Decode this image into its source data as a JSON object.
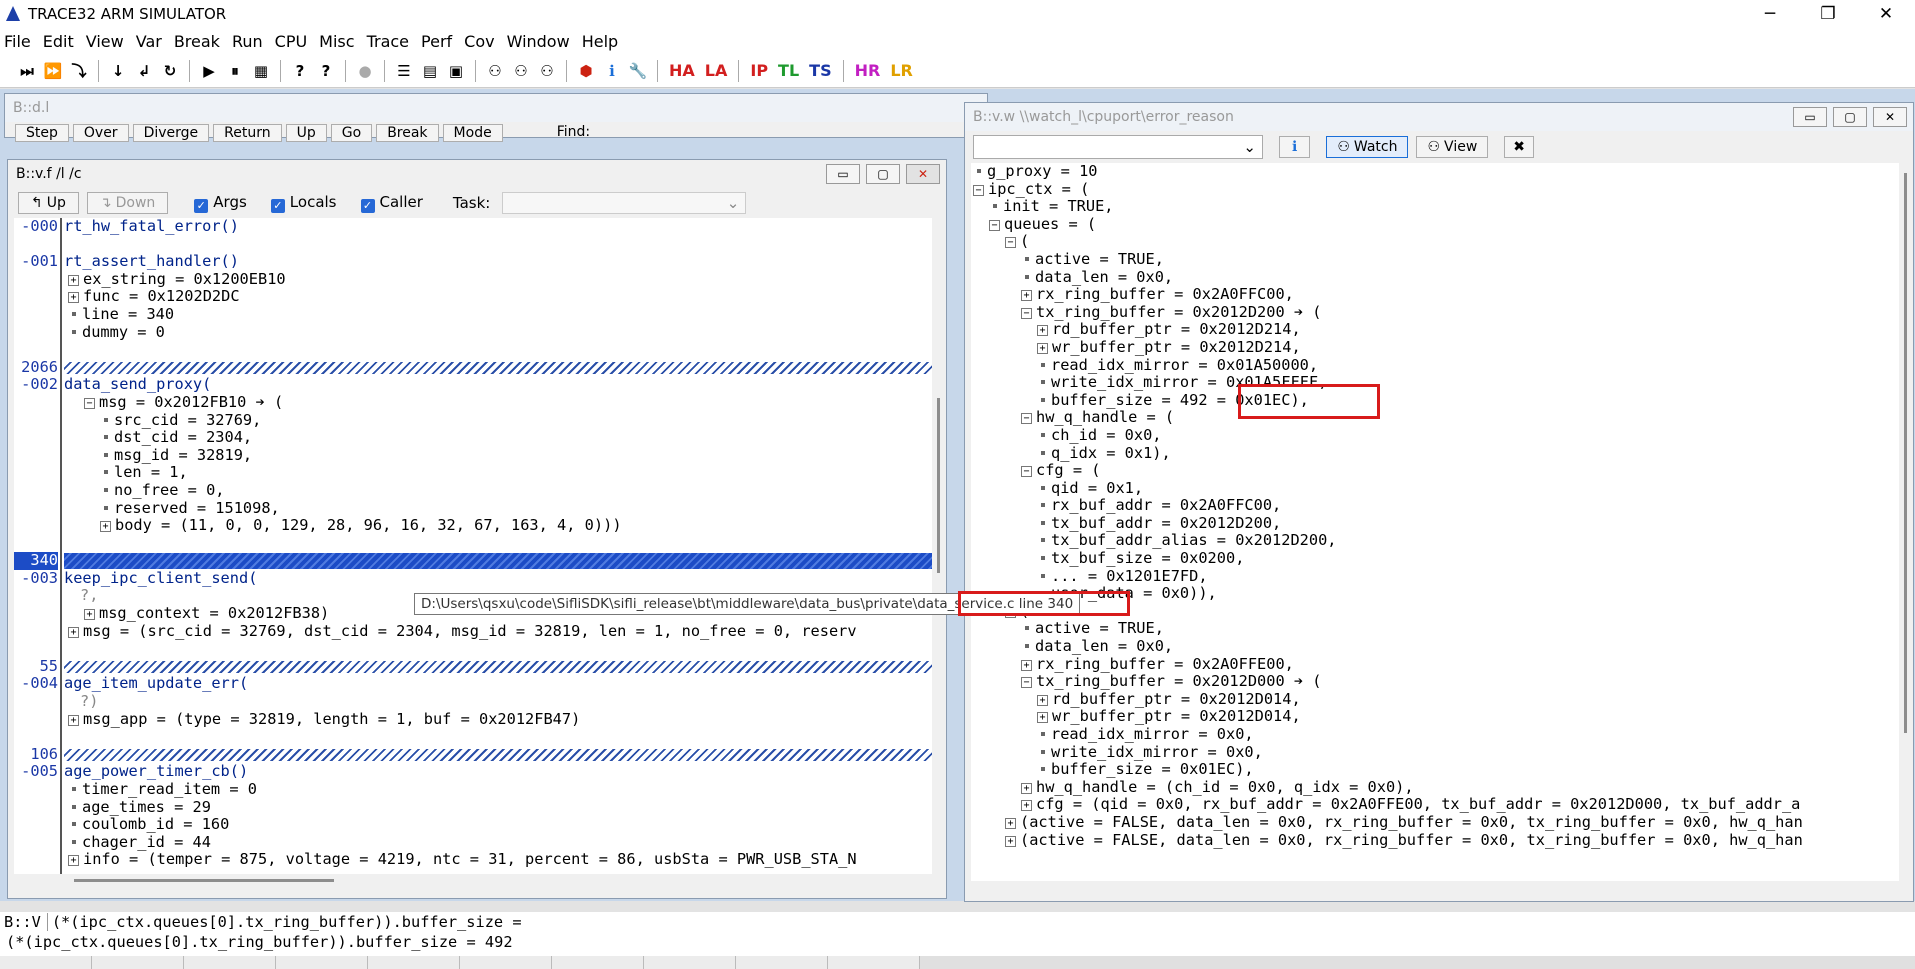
{
  "app": {
    "title": "TRACE32 ARM SIMULATOR"
  },
  "window_controls": {
    "min": "─",
    "max": "❐",
    "close": "✕"
  },
  "menu": [
    "File",
    "Edit",
    "View",
    "Var",
    "Break",
    "Run",
    "CPU",
    "Misc",
    "Trace",
    "Perf",
    "Cov",
    "Window",
    "Help"
  ],
  "toolbar": {
    "text_buttons": [
      {
        "label": "HA",
        "color": "#d21f1f"
      },
      {
        "label": "LA",
        "color": "#d21f1f"
      },
      {
        "label": "IP",
        "color": "#d21f1f"
      },
      {
        "label": "TL",
        "color": "#1e9a2e"
      },
      {
        "label": "TS",
        "color": "#1a37a6"
      },
      {
        "label": "HR",
        "color": "#c21fc2"
      },
      {
        "label": "LR",
        "color": "#e0a000"
      }
    ]
  },
  "list_window": {
    "title": "B::d.l",
    "buttons": [
      "Step",
      "Over",
      "Diverge",
      "Return",
      "Up",
      "Go",
      "Break",
      "Mode"
    ],
    "find_label": "Find:"
  },
  "frame_window": {
    "title": "B::v.f /l /c",
    "up": "Up",
    "down": "Down",
    "args": "Args",
    "locals": "Locals",
    "caller": "Caller",
    "task_label": "Task:",
    "rows": [
      {
        "ln": "-000",
        "text": "rt_hw_fatal_error()",
        "k": "fn"
      },
      {
        "ln": "",
        "text": "",
        "k": "blank"
      },
      {
        "ln": "-001",
        "text": "rt_assert_handler()",
        "k": "fn"
      },
      {
        "ln": "",
        "text": "ex_string = 0x1200EB10",
        "k": "plus",
        "ind": 0
      },
      {
        "ln": "",
        "text": "func = 0x1202D2DC",
        "k": "plus",
        "ind": 0
      },
      {
        "ln": "",
        "text": "line = 340",
        "k": "dot",
        "ind": 0
      },
      {
        "ln": "",
        "text": "dummy = 0",
        "k": "dot",
        "ind": 0
      },
      {
        "ln": "",
        "text": "",
        "k": "blank"
      },
      {
        "ln": "2066",
        "text": "",
        "k": "hatch"
      },
      {
        "ln": "-002",
        "text": "data_send_proxy(",
        "k": "fn"
      },
      {
        "ln": "",
        "text": "msg = 0x2012FB10 ➔ (",
        "k": "minus",
        "ind": 1
      },
      {
        "ln": "",
        "text": "src_cid = 32769,",
        "k": "dot",
        "ind": 2
      },
      {
        "ln": "",
        "text": "dst_cid = 2304,",
        "k": "dot",
        "ind": 2
      },
      {
        "ln": "",
        "text": "msg_id = 32819,",
        "k": "dot",
        "ind": 2
      },
      {
        "ln": "",
        "text": "len = 1,",
        "k": "dot",
        "ind": 2
      },
      {
        "ln": "",
        "text": "no_free = 0,",
        "k": "dot",
        "ind": 2
      },
      {
        "ln": "",
        "text": "reserved = 151098,",
        "k": "dot",
        "ind": 2
      },
      {
        "ln": "",
        "text": "body = (11, 0, 0, 129, 28, 96, 16, 32, 67, 163, 4, 0)))",
        "k": "plus",
        "ind": 2
      },
      {
        "ln": "",
        "text": "",
        "k": "blank"
      },
      {
        "ln": "340",
        "text": "",
        "k": "hatchsel"
      },
      {
        "ln": "-003",
        "text": "keep_ipc_client_send(",
        "k": "fn"
      },
      {
        "ln": "",
        "text": "?,",
        "k": "q"
      },
      {
        "ln": "",
        "text": "msg_context = 0x2012FB38)",
        "k": "plus",
        "ind": 1
      },
      {
        "ln": "",
        "text": "msg = (src_cid = 32769, dst_cid = 2304, msg_id = 32819, len = 1, no_free = 0, reserv",
        "k": "plus",
        "ind": 0
      },
      {
        "ln": "",
        "text": "",
        "k": "blank"
      },
      {
        "ln": "55",
        "text": "",
        "k": "hatch"
      },
      {
        "ln": "-004",
        "text": "age_item_update_err(",
        "k": "fn"
      },
      {
        "ln": "",
        "text": "?)",
        "k": "q"
      },
      {
        "ln": "",
        "text": "msg_app = (type = 32819, length = 1, buf = 0x2012FB47)",
        "k": "plus",
        "ind": 0
      },
      {
        "ln": "",
        "text": "",
        "k": "blank"
      },
      {
        "ln": "106",
        "text": "",
        "k": "hatch"
      },
      {
        "ln": "-005",
        "text": "age_power_timer_cb()",
        "k": "fn"
      },
      {
        "ln": "",
        "text": "timer_read_item = 0",
        "k": "dot",
        "ind": 0
      },
      {
        "ln": "",
        "text": "age_times = 29",
        "k": "dot",
        "ind": 0
      },
      {
        "ln": "",
        "text": "coulomb_id = 160",
        "k": "dot",
        "ind": 0
      },
      {
        "ln": "",
        "text": "chager_id = 44",
        "k": "dot",
        "ind": 0
      },
      {
        "ln": "",
        "text": "info = (temper = 875, voltage = 4219, ntc = 31, percent = 86, usbSta = PWR_USB_STA_N",
        "k": "plus",
        "ind": 0
      }
    ]
  },
  "tooltip": {
    "path": "D:\\Users\\qsxu\\code\\SifliSDK\\sifli_release\\bt\\middleware\\data_bus\\private\\data_service.c line 340"
  },
  "watch_window": {
    "title": "B::v.w \\\\watch_l\\cpuport\\error_reason",
    "watch_btn": "Watch",
    "view_btn": "View",
    "rows": [
      {
        "text": "g_proxy = 10",
        "k": "dot",
        "ind": 0
      },
      {
        "text": "ipc_ctx = (",
        "k": "minus",
        "ind": 0
      },
      {
        "text": "init = TRUE,",
        "k": "dot",
        "ind": 1
      },
      {
        "text": "queues = (",
        "k": "minus",
        "ind": 1
      },
      {
        "text": "(",
        "k": "minus",
        "ind": 2
      },
      {
        "text": "active = TRUE,",
        "k": "dot",
        "ind": 3
      },
      {
        "text": "data_len = 0x0,",
        "k": "dot",
        "ind": 3
      },
      {
        "text": "rx_ring_buffer = 0x2A0FFC00,",
        "k": "plus",
        "ind": 3
      },
      {
        "text": "tx_ring_buffer = 0x2012D200 ➔ (",
        "k": "minus",
        "ind": 3
      },
      {
        "text": "rd_buffer_ptr = 0x2012D214,",
        "k": "plus",
        "ind": 4
      },
      {
        "text": "wr_buffer_ptr = 0x2012D214,",
        "k": "plus",
        "ind": 4
      },
      {
        "text": "read_idx_mirror = 0x01A50000,",
        "k": "dot",
        "ind": 4
      },
      {
        "text": "write_idx_mirror = 0x01A5FFFF,",
        "k": "dot",
        "ind": 4
      },
      {
        "text": "buffer_size = 492 = 0x01EC),",
        "k": "dot",
        "ind": 4
      },
      {
        "text": "hw_q_handle = (",
        "k": "minus",
        "ind": 3
      },
      {
        "text": "ch_id = 0x0,",
        "k": "dot",
        "ind": 4
      },
      {
        "text": "q_idx = 0x1),",
        "k": "dot",
        "ind": 4
      },
      {
        "text": "cfg = (",
        "k": "minus",
        "ind": 3
      },
      {
        "text": "qid = 0x1,",
        "k": "dot",
        "ind": 4
      },
      {
        "text": "rx_buf_addr = 0x2A0FFC00,",
        "k": "dot",
        "ind": 4
      },
      {
        "text": "tx_buf_addr = 0x2012D200,",
        "k": "dot",
        "ind": 4
      },
      {
        "text": "tx_buf_addr_alias = 0x2012D200,",
        "k": "dot",
        "ind": 4
      },
      {
        "text": "tx_buf_size = 0x0200,",
        "k": "dot",
        "ind": 4
      },
      {
        "text": "... = 0x1201E7FD,",
        "k": "dot",
        "ind": 4
      },
      {
        "text": "user_data = 0x0)),",
        "k": "dot",
        "ind": 4
      },
      {
        "text": "(",
        "k": "minus",
        "ind": 2
      },
      {
        "text": "active = TRUE,",
        "k": "dot",
        "ind": 3
      },
      {
        "text": "data_len = 0x0,",
        "k": "dot",
        "ind": 3
      },
      {
        "text": "rx_ring_buffer = 0x2A0FFE00,",
        "k": "plus",
        "ind": 3
      },
      {
        "text": "tx_ring_buffer = 0x2012D000 ➔ (",
        "k": "minus",
        "ind": 3
      },
      {
        "text": "rd_buffer_ptr = 0x2012D014,",
        "k": "plus",
        "ind": 4
      },
      {
        "text": "wr_buffer_ptr = 0x2012D014,",
        "k": "plus",
        "ind": 4
      },
      {
        "text": "read_idx_mirror = 0x0,",
        "k": "dot",
        "ind": 4
      },
      {
        "text": "write_idx_mirror = 0x0,",
        "k": "dot",
        "ind": 4
      },
      {
        "text": "buffer_size = 0x01EC),",
        "k": "dot",
        "ind": 4
      },
      {
        "text": "hw_q_handle = (ch_id = 0x0, q_idx = 0x0),",
        "k": "plus",
        "ind": 3
      },
      {
        "text": "cfg = (qid = 0x0, rx_buf_addr = 0x2A0FFE00, tx_buf_addr = 0x2012D000, tx_buf_addr_a",
        "k": "plus",
        "ind": 3
      },
      {
        "text": "(active = FALSE, data_len = 0x0, rx_ring_buffer = 0x0, tx_ring_buffer = 0x0, hw_q_han",
        "k": "plus",
        "ind": 2
      },
      {
        "text": "(active = FALSE, data_len = 0x0, rx_ring_buffer = 0x0, tx_ring_buffer = 0x0, hw_q_han",
        "k": "plus",
        "ind": 2
      }
    ]
  },
  "command": {
    "prompt": "B::V",
    "input": "(*(ipc_ctx.queues[0].tx_ring_buffer)).buffer_size =",
    "result": "(*(ipc_ctx.queues[0].tx_ring_buffer)).buffer_size = 492"
  }
}
